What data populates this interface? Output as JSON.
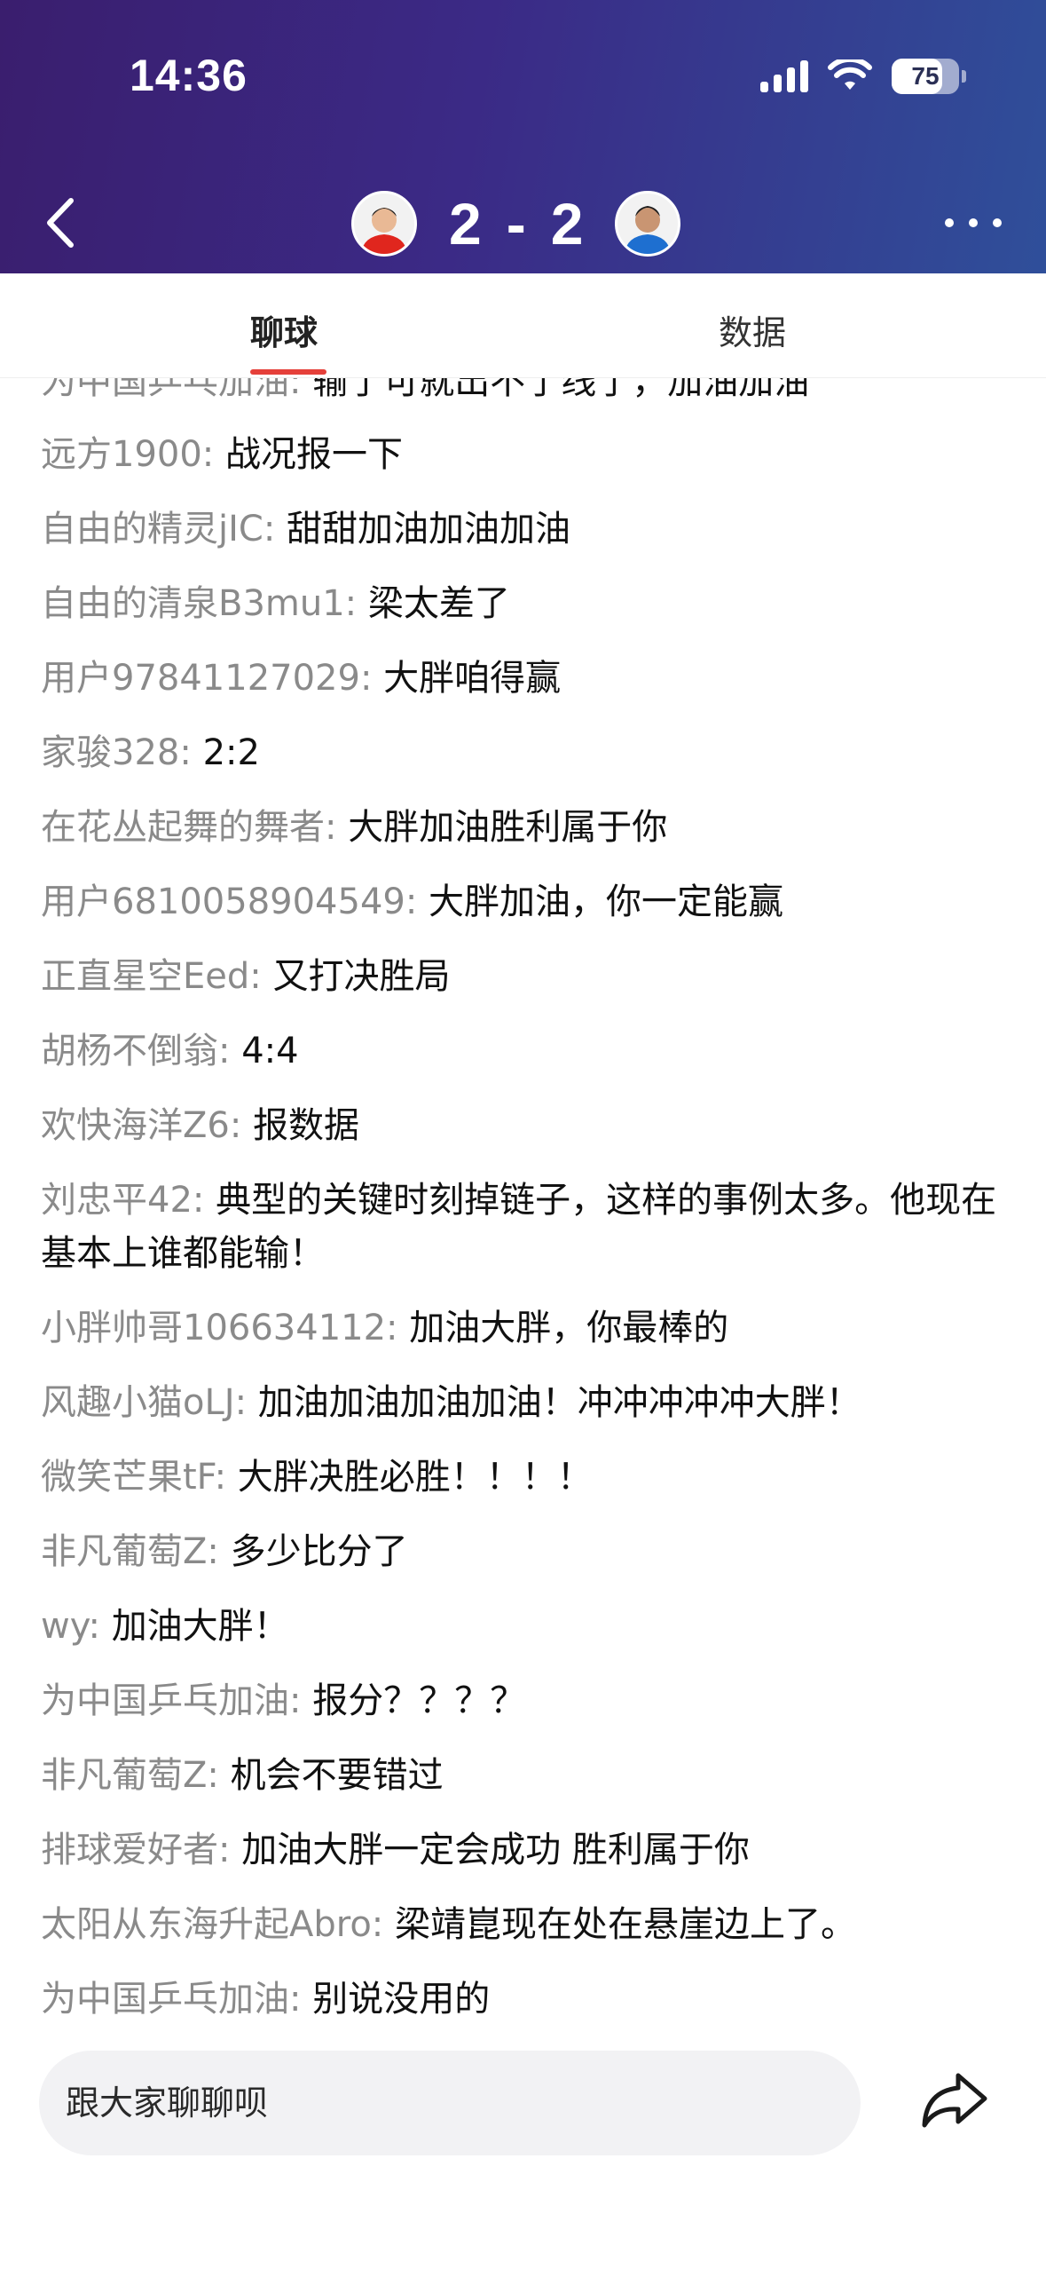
{
  "status_bar": {
    "time": "14:36",
    "battery": "75",
    "battery_level": 0.75
  },
  "match": {
    "home_score": "2",
    "separator": "-",
    "away_score": "2"
  },
  "tabs": [
    {
      "label": "聊球",
      "active": true
    },
    {
      "label": "数据",
      "active": false
    }
  ],
  "chat": {
    "messages": [
      {
        "user": "为中国乒乓加油",
        "text": "输了可就出不了线了，加油加油"
      },
      {
        "user": "远方1900",
        "text": "战况报一下"
      },
      {
        "user": "自由的精灵jIC",
        "text": "甜甜加油加油加油"
      },
      {
        "user": "自由的清泉B3mu1",
        "text": "梁太差了"
      },
      {
        "user": "用户97841127029",
        "text": "大胖咱得赢"
      },
      {
        "user": "家骏328",
        "text": "2:2"
      },
      {
        "user": "在花丛起舞的舞者",
        "text": "大胖加油胜利属于你"
      },
      {
        "user": "用户6810058904549",
        "text": "大胖加油，你一定能赢"
      },
      {
        "user": "正直星空Eed",
        "text": "又打决胜局"
      },
      {
        "user": "胡杨不倒翁",
        "text": "4:4"
      },
      {
        "user": "欢快海洋Z6",
        "text": "报数据"
      },
      {
        "user": "刘忠平42",
        "text": "典型的关键时刻掉链子，这样的事例太多。他现在基本上谁都能输！"
      },
      {
        "user": "小胖帅哥106634112",
        "text": "加油大胖，你最棒的"
      },
      {
        "user": "风趣小猫oLJ",
        "text": "加油加油加油加油！冲冲冲冲冲大胖！"
      },
      {
        "user": "微笑芒果tF",
        "text": "大胖决胜必胜！！！！"
      },
      {
        "user": "非凡葡萄Z",
        "text": "多少比分了"
      },
      {
        "user": "wy",
        "text": "加油大胖！"
      },
      {
        "user": "为中国乒乓加油",
        "text": "报分？？？？"
      },
      {
        "user": "非凡葡萄Z",
        "text": "机会不要错过"
      },
      {
        "user": "排球爱好者",
        "text": "加油大胖一定会成功 胜利属于你"
      },
      {
        "user": "太阳从东海升起Abro",
        "text": "梁靖崑现在处在悬崖边上了。"
      },
      {
        "user": "为中国乒乓加油",
        "text": "别说没用的"
      }
    ]
  },
  "input": {
    "placeholder": "跟大家聊聊呗"
  },
  "icons": {
    "back": "chevron-left-icon",
    "more": "more-dots-icon",
    "share": "share-arrow-icon",
    "signal": "cellular-signal-icon",
    "wifi": "wifi-icon",
    "battery": "battery-icon"
  },
  "colors": {
    "header_start": "#3a1e6e",
    "header_end": "#2f4f9a",
    "tab_accent": "#e5403a",
    "username": "#8a8a8a"
  }
}
